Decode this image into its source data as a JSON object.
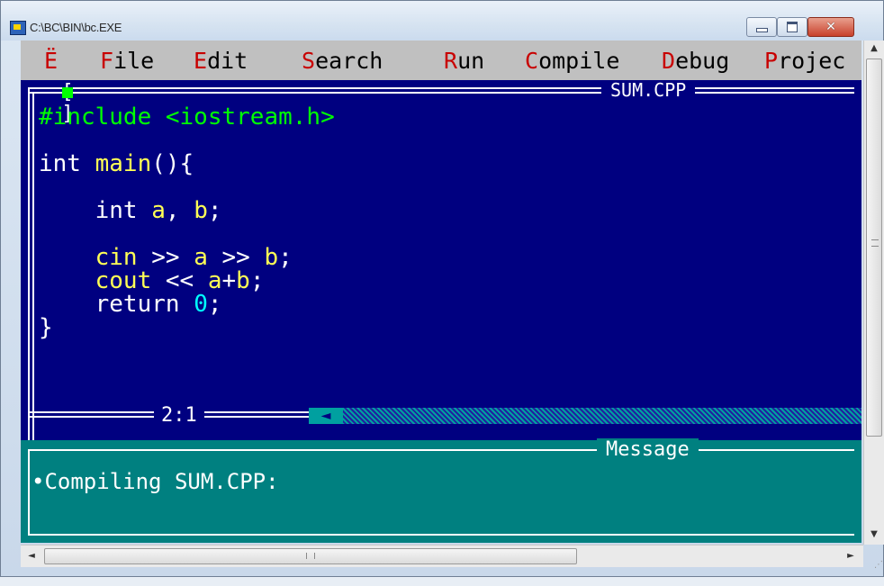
{
  "window": {
    "title": "C:\\BC\\BIN\\bc.EXE",
    "close_glyph": "✕"
  },
  "menu": {
    "items": [
      {
        "hot": "Ë",
        "rest": ""
      },
      {
        "hot": "F",
        "rest": "ile"
      },
      {
        "hot": "E",
        "rest": "dit"
      },
      {
        "hot": "S",
        "rest": "earch"
      },
      {
        "hot": "R",
        "rest": "un"
      },
      {
        "hot": "C",
        "rest": "ompile"
      },
      {
        "hot": "D",
        "rest": "ebug"
      },
      {
        "hot": "P",
        "rest": "rojec"
      }
    ]
  },
  "editor": {
    "filename": "SUM.CPP",
    "close_box_glyph": "[ ]",
    "cursor_position": "2:1",
    "code_lines": [
      [
        {
          "t": "#include <iostream.h>",
          "c": "pp"
        }
      ],
      [],
      [
        {
          "t": "int ",
          "c": "kw"
        },
        {
          "t": "main",
          "c": "id"
        },
        {
          "t": "(){",
          "c": "op"
        }
      ],
      [],
      [
        {
          "t": "    int ",
          "c": "kw"
        },
        {
          "t": "a",
          "c": "id"
        },
        {
          "t": ", ",
          "c": "op"
        },
        {
          "t": "b",
          "c": "id"
        },
        {
          "t": ";",
          "c": "op"
        }
      ],
      [],
      [
        {
          "t": "    cin",
          "c": "id"
        },
        {
          "t": " >> ",
          "c": "op"
        },
        {
          "t": "a",
          "c": "id"
        },
        {
          "t": " >> ",
          "c": "op"
        },
        {
          "t": "b",
          "c": "id"
        },
        {
          "t": ";",
          "c": "op"
        }
      ],
      [
        {
          "t": "    cout",
          "c": "id"
        },
        {
          "t": " << ",
          "c": "op"
        },
        {
          "t": "a",
          "c": "id"
        },
        {
          "t": "+",
          "c": "op"
        },
        {
          "t": "b",
          "c": "id"
        },
        {
          "t": ";",
          "c": "op"
        }
      ],
      [
        {
          "t": "    return ",
          "c": "kw"
        },
        {
          "t": "0",
          "c": "num"
        },
        {
          "t": ";",
          "c": "op"
        }
      ],
      [
        {
          "t": "}",
          "c": "op"
        }
      ]
    ]
  },
  "message_pane": {
    "title": "Message",
    "text": "•Compiling SUM.CPP:"
  },
  "colors": {
    "editor_bg": "#000080",
    "menu_bg": "#c0c0c0",
    "message_bg": "#008080",
    "hotkey": "#c80000"
  },
  "icons": [
    "app-icon",
    "minimize-icon",
    "maximize-icon",
    "close-icon",
    "scroll-up-icon",
    "scroll-down-icon",
    "scroll-left-icon",
    "scroll-right-icon"
  ]
}
